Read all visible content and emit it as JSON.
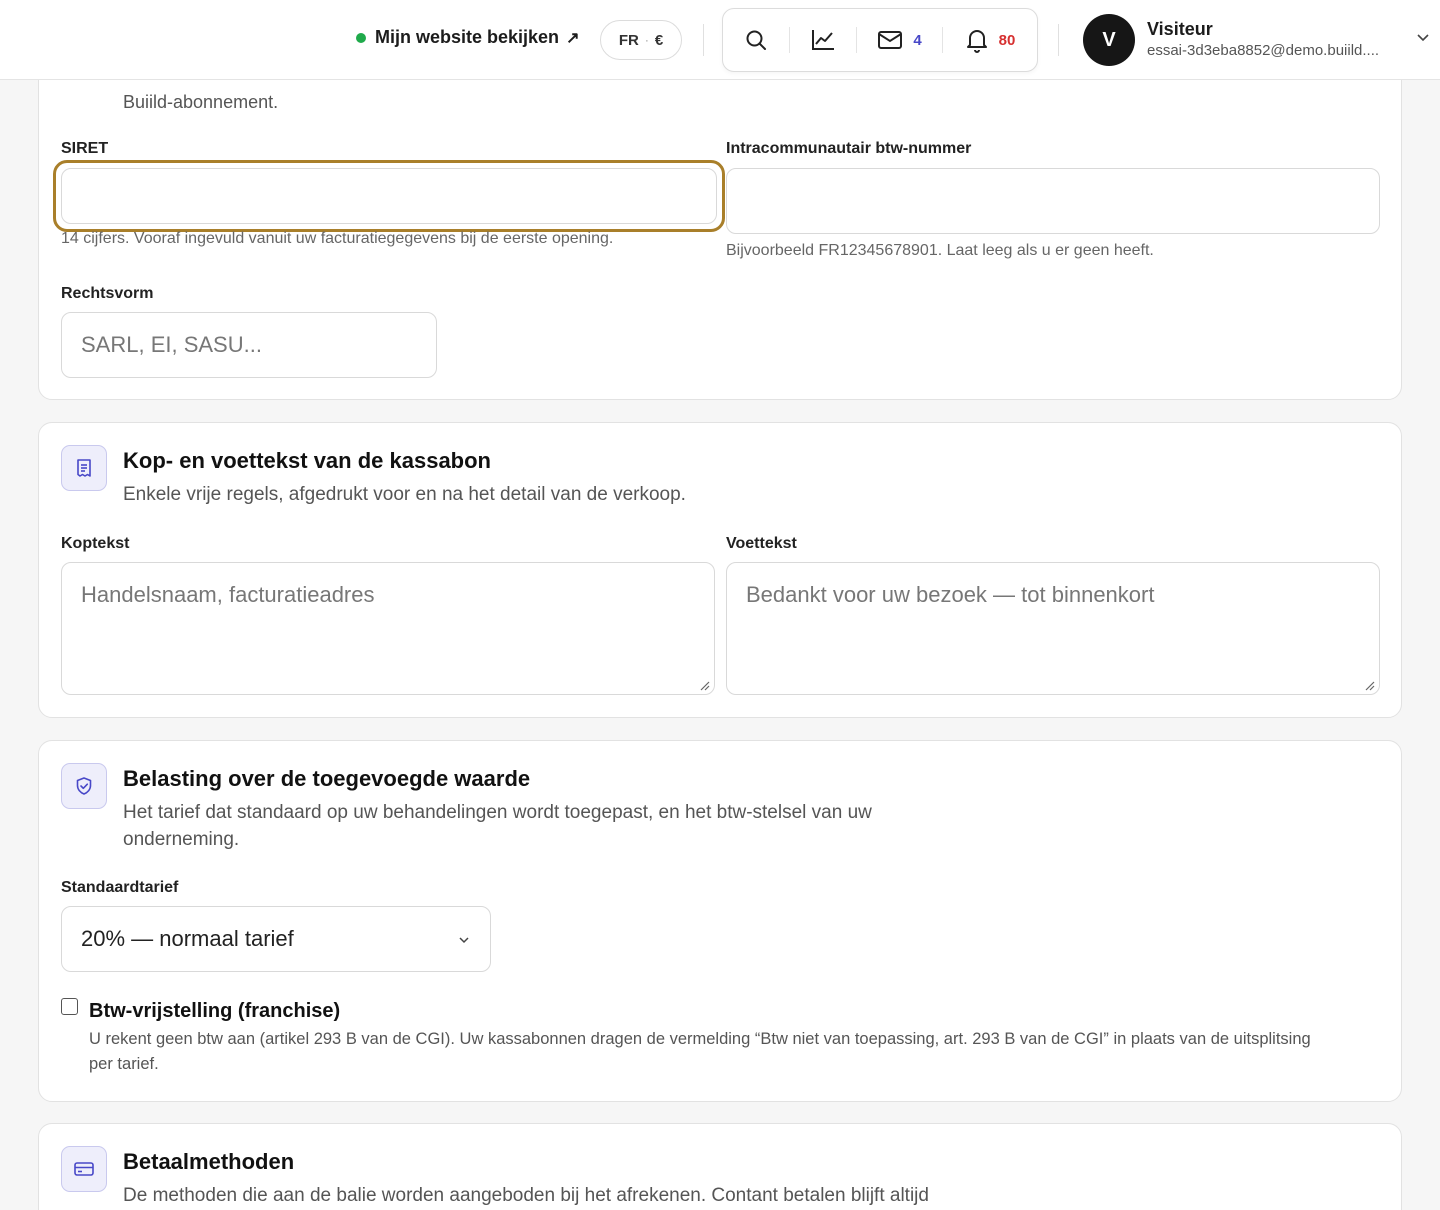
{
  "header": {
    "site_link": "Mijn website bekijken",
    "site_link_arrow": "↗",
    "lang": "FR",
    "currency": "€",
    "mail_count": "4",
    "notif_count": "80",
    "user_initial": "V",
    "user_name": "Visiteur",
    "user_email": "essai-3d3eba8852@demo.buiild...."
  },
  "colors": {
    "accent": "#4848c8",
    "badge_red": "#d63030",
    "focus": "#a97f2a",
    "status_green": "#1faa4b"
  },
  "company": {
    "prev_help": "Buiild-abonnement.",
    "siret_label": "SIRET",
    "siret_value": "",
    "siret_help": "14 cijfers. Vooraf ingevuld vanuit uw facturatiegegevens bij de eerste opening.",
    "vat_label": "Intracommunautair btw-nummer",
    "vat_value": "",
    "vat_help": "Bijvoorbeeld FR12345678901. Laat leeg als u er geen heeft.",
    "legal_label": "Rechtsvorm",
    "legal_placeholder": "SARL, EI, SASU..."
  },
  "receipt": {
    "icon": "receipt-icon",
    "title": "Kop- en voettekst van de kassabon",
    "desc": "Enkele vrije regels, afgedrukt voor en na het detail van de verkoop.",
    "header_label": "Koptekst",
    "header_placeholder": "Handelsnaam, facturatieadres",
    "footer_label": "Voettekst",
    "footer_placeholder": "Bedankt voor uw bezoek — tot binnenkort"
  },
  "vat": {
    "icon": "shield-check-icon",
    "title": "Belasting over de toegevoegde waarde",
    "desc_line1": "Het tarief dat standaard op uw behandelingen wordt toegepast, en het btw-stelsel van uw",
    "desc_line2": "onderneming.",
    "rate_label": "Standaardtarief",
    "rate_selected": "20% — normaal tarief",
    "exempt_label": "Btw-vrijstelling (franchise)",
    "exempt_checked": false,
    "exempt_help_line1": "U rekent geen btw aan (artikel 293 B van de CGI). Uw kassabonnen dragen de vermelding “Btw niet van toepassing, art. 293 B van de CGI” in plaats van de uitsplitsing",
    "exempt_help_line2": "per tarief."
  },
  "payment": {
    "icon": "credit-card-icon",
    "title": "Betaalmethoden",
    "desc": "De methoden die aan de balie worden aangeboden bij het afrekenen. Contant betalen blijft altijd"
  }
}
